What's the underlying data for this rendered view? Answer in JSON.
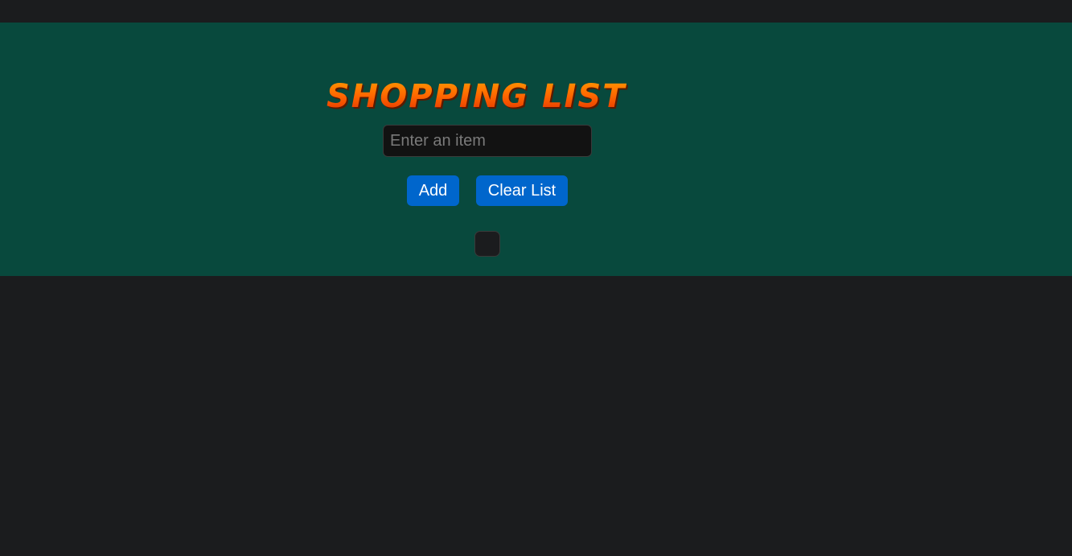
{
  "app": {
    "title": "Shopping List"
  },
  "form": {
    "input_value": "",
    "input_placeholder": "Enter an item",
    "add_label": "Add",
    "clear_label": "Clear List"
  },
  "list": {
    "items": []
  },
  "colors": {
    "page_background": "#1b1c1e",
    "panel_background": "#08493d",
    "button_background": "#0066cc",
    "title_gradient_top": "#ffa000",
    "title_gradient_bottom": "#e02a00"
  }
}
